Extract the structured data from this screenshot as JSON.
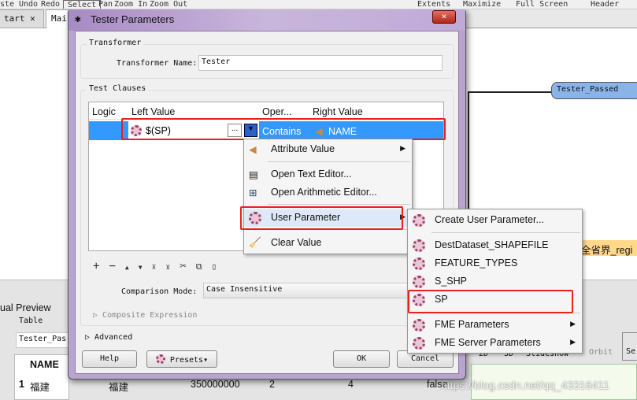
{
  "toolbar": {
    "items": [
      "ste",
      "Undo",
      "Redo",
      "Select",
      "Pan",
      "Zoom In",
      "Zoom Out",
      "Extents",
      "Maximize",
      "Full Screen",
      "Header"
    ]
  },
  "tabs": {
    "start": "tart",
    "main": "Mai"
  },
  "canvas": {
    "node": "Tester_Passed",
    "feature": "全省界_regi"
  },
  "preview": {
    "title": "ual Preview",
    "table_label": "Table",
    "table_select": "Tester_Pas",
    "col_name": "NAME",
    "row": [
      "1",
      "福建",
      "福建",
      "350000000",
      "2",
      "4",
      "false"
    ],
    "view_tabs": [
      "2D",
      "3D",
      "Slideshow"
    ],
    "orbit": "Orbit",
    "select": "Se"
  },
  "watermark": "https://blog.csdn.net/qq_43316411",
  "dialog": {
    "title": "Tester Parameters",
    "transformer_group": "Transformer",
    "name_label": "Transformer Name:",
    "name_value": "Tester",
    "clauses_group": "Test Clauses",
    "columns": [
      "Logic",
      "Left Value",
      "Oper...",
      "Right Value"
    ],
    "row": {
      "left": "$(SP)",
      "dots": "...",
      "operator": "Contains",
      "right": "NAME"
    },
    "mode_label": "Comparison Mode:",
    "mode_value": "Case Insensitive",
    "composite": "Composite Expression",
    "advanced": "Advanced",
    "help": "Help",
    "presets": "Presets",
    "ok": "OK",
    "cancel": "Cancel"
  },
  "menu1": [
    "Attribute Value",
    "Open Text Editor...",
    "Open Arithmetic Editor...",
    "User Parameter",
    "Clear Value"
  ],
  "menu2": [
    "Create User Parameter...",
    "DestDataset_SHAPEFILE",
    "FEATURE_TYPES",
    "S_SHP",
    "SP",
    "FME Parameters",
    "FME Server Parameters"
  ],
  "colors": {
    "selection": "#3399ff",
    "highlight": "#e8201e",
    "title": "#a78bc4"
  }
}
